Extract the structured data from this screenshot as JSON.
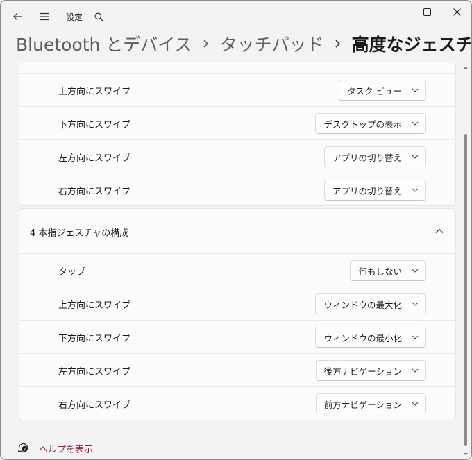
{
  "app": {
    "title": "設定"
  },
  "window_controls": {
    "minimize": "minimize",
    "maximize": "maximize",
    "close": "close"
  },
  "breadcrumb": {
    "items": [
      "Bluetooth とデバイス",
      "タッチパッド",
      "高度なジェスチャ"
    ]
  },
  "three_finger_rows": [
    {
      "label": "上方向にスワイプ",
      "value": "タスク ビュー"
    },
    {
      "label": "下方向にスワイプ",
      "value": "デスクトップの表示"
    },
    {
      "label": "左方向にスワイプ",
      "value": "アプリの切り替え"
    },
    {
      "label": "右方向にスワイプ",
      "value": "アプリの切り替え"
    }
  ],
  "four_finger_section": {
    "title": "4 本指ジェスチャの構成",
    "rows": [
      {
        "label": "タップ",
        "value": "何もしない"
      },
      {
        "label": "上方向にスワイプ",
        "value": "ウィンドウの最大化"
      },
      {
        "label": "下方向にスワイプ",
        "value": "ウィンドウの最小化"
      },
      {
        "label": "左方向にスワイプ",
        "value": "後方ナビゲーション"
      },
      {
        "label": "右方向にスワイプ",
        "value": "前方ナビゲーション"
      }
    ]
  },
  "help": {
    "label": "ヘルプを表示"
  },
  "colors": {
    "accent_link": "#9b1b50",
    "background": "#f3f3f3",
    "card": "#fbfbfb"
  }
}
